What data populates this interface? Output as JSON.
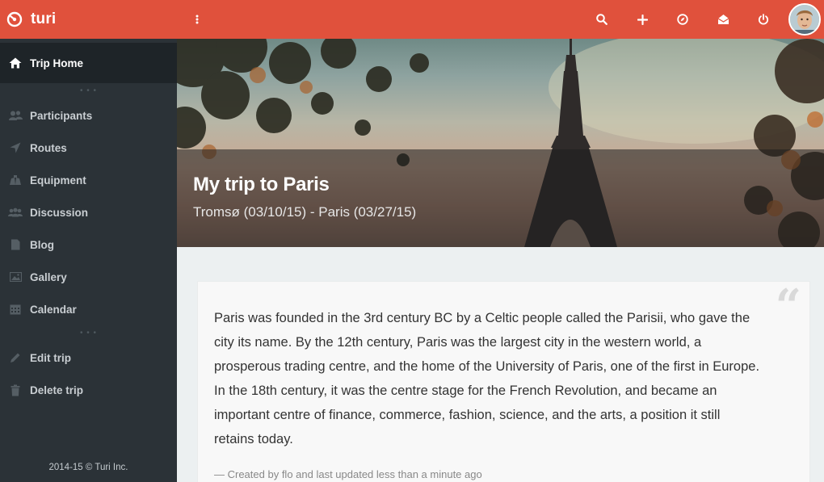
{
  "brand": {
    "name": "turi"
  },
  "colors": {
    "accent": "#e0513c",
    "sidebar": "#2b3237",
    "sidebar_active": "#1e2428"
  },
  "topbar": {
    "icons": [
      "search-icon",
      "plus-icon",
      "compass-icon",
      "mail-icon",
      "power-icon"
    ]
  },
  "sidebar": {
    "items": [
      {
        "label": "Trip Home",
        "icon": "home-icon"
      },
      {
        "label": "Participants",
        "icon": "users-icon"
      },
      {
        "label": "Routes",
        "icon": "route-icon"
      },
      {
        "label": "Equipment",
        "icon": "equipment-icon"
      },
      {
        "label": "Discussion",
        "icon": "discussion-icon"
      },
      {
        "label": "Blog",
        "icon": "blog-icon"
      },
      {
        "label": "Gallery",
        "icon": "gallery-icon"
      },
      {
        "label": "Calendar",
        "icon": "calendar-icon"
      },
      {
        "label": "Edit trip",
        "icon": "pencil-icon"
      },
      {
        "label": "Delete trip",
        "icon": "trash-icon"
      }
    ],
    "footer": "2014-15 © Turi Inc."
  },
  "hero": {
    "title": "My trip to Paris",
    "subtitle": "Tromsø (03/10/15) - Paris (03/27/15)"
  },
  "description": {
    "text": "Paris was founded in the 3rd century BC by a Celtic people called the Parisii, who gave the city its name. By the 12th century, Paris was the largest city in the western world, a prosperous trading centre, and the home of the University of Paris, one of the first in Europe. In the 18th century, it was the centre stage for the French Revolution, and became an important centre of finance, commerce, fashion, science, and the arts, a position it still retains today.",
    "quote_mark": "“",
    "meta": "— Created by flo and last updated less than a minute ago"
  }
}
